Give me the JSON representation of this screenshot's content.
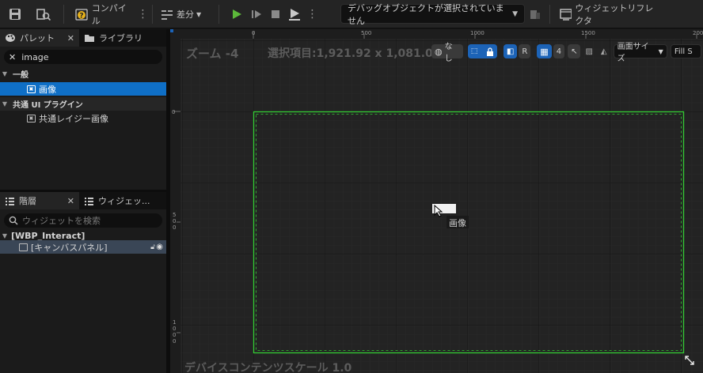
{
  "toolbar": {
    "compile_label": "コンパイル",
    "diff_label": "差分",
    "debug_dropdown": "デバッグオブジェクトが選択されていません",
    "widget_reflector_label": "ウィジェットリフレクタ"
  },
  "palette": {
    "tab_palette": "パレット",
    "tab_library": "ライブラリ",
    "search_value": "image",
    "category_common": "一般",
    "item_image": "画像",
    "category_common_ui": "共通 UI プラグイン",
    "item_lazy_image": "共通レイジー画像"
  },
  "hierarchy": {
    "tab_hierarchy": "階層",
    "tab_widget": "ウィジェッ...",
    "search_placeholder": "ウィジェットを検索",
    "root_label": "[WBP_Interact]",
    "child_label": "[キャンバスパネル]"
  },
  "viewport": {
    "zoom_label": "ズーム -4",
    "selection_label": "選択項目:1,921.92 x 1,081.08",
    "none_label": "なし",
    "r_label": "R",
    "grid_size": "4",
    "screen_size_label": "画面サイズ",
    "fill_label": "Fill S",
    "dpi_label": "デバイスコンテンツスケール 1.0",
    "image_tooltip": "画像",
    "ruler_top": [
      "0",
      "500",
      "1000",
      "1500",
      "200"
    ],
    "ruler_left": [
      "0",
      "500",
      "1000"
    ]
  },
  "colors": {
    "accent_blue": "#0f6fc6",
    "selection_green": "#33cc33",
    "play_green": "#5cb83a"
  }
}
